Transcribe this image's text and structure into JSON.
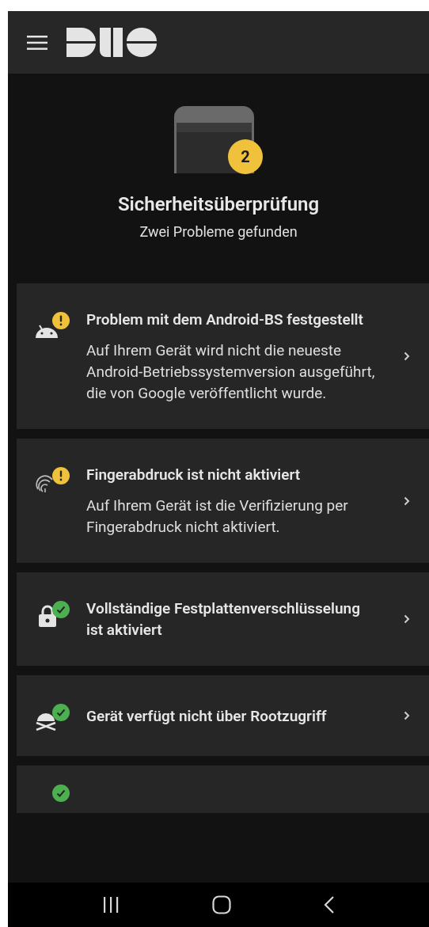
{
  "header": {
    "badge_count": "2",
    "title": "Sicherheitsüberprüfung",
    "subtitle": "Zwei Probleme gefunden"
  },
  "checks": [
    {
      "kind": "android",
      "passed": false,
      "title": "Problem mit dem Android-BS festgestellt",
      "description": "Auf Ihrem Gerät wird nicht die neueste Android-Betriebssystemversion ausgeführt, die von Google veröffentlicht wurde."
    },
    {
      "kind": "fingerprint",
      "passed": false,
      "title": "Fingerabdruck ist nicht aktiviert",
      "description": "Auf Ihrem Gerät ist die Verifizierung per Fingerabdruck nicht aktiviert."
    },
    {
      "kind": "lock",
      "passed": true,
      "title": "Vollständige Festplattenverschlüsselung ist aktiviert"
    },
    {
      "kind": "root",
      "passed": true,
      "title": "Gerät verfügt nicht über Rootzugriff"
    },
    {
      "kind": "other",
      "passed": true
    }
  ]
}
